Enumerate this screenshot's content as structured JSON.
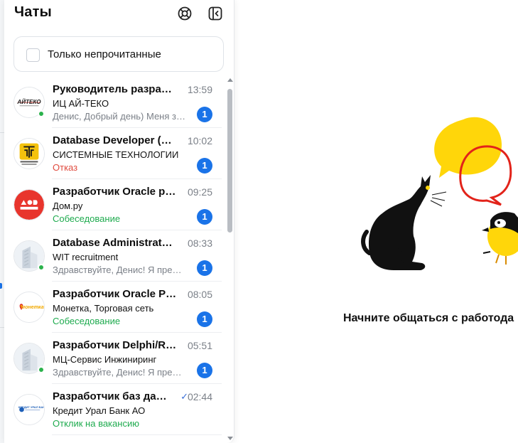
{
  "chat": {
    "title": "Чаты",
    "filter_label": "Только непрочитанные",
    "items": [
      {
        "title": "Руководитель разраб…",
        "time": "13:59",
        "company": "ИЦ АЙ-ТЕКО",
        "status": "Денис, Добрый день) Меня з…",
        "status_color": "#7b8088",
        "unread": "1",
        "online": true,
        "logo": "aiteko",
        "logo_text": "АЙТЕКО"
      },
      {
        "title": "Database Developer (О…",
        "time": "10:02",
        "company": "СИСТЕМНЫЕ ТЕХНОЛОГИИ",
        "status": "Отказ",
        "status_color": "#e04b3f",
        "unread": "1",
        "online": false,
        "logo": "sistech",
        "logo_text": "СИСТЕМНЫЕ ТЕХНОЛОГИИ"
      },
      {
        "title": "Разработчик Oracle pl…",
        "time": "09:25",
        "company": "Дом.ру",
        "status": "Собеседование",
        "status_color": "#1fab4f",
        "unread": "1",
        "online": false,
        "logo": "domru",
        "logo_text": "ДОМ.РУ"
      },
      {
        "title": "Database Administrat…",
        "time": "08:33",
        "company": "WIT recruitment",
        "status": "Здравствуйте, Денис! Я пре…",
        "status_color": "#7b8088",
        "unread": "1",
        "online": true,
        "logo": "building",
        "logo_text": ""
      },
      {
        "title": "Разработчик Oracle P…",
        "time": "08:05",
        "company": "Монетка, Торговая сеть",
        "status": "Собеседование",
        "status_color": "#1fab4f",
        "unread": "1",
        "online": false,
        "logo": "monetka",
        "logo_text": "монетка"
      },
      {
        "title": "Разработчик Delphi/R…",
        "time": "05:51",
        "company": "МЦ-Сервис Инжиниринг",
        "status": "Здравствуйте, Денис! Я пре…",
        "status_color": "#7b8088",
        "unread": "1",
        "online": true,
        "logo": "building",
        "logo_text": ""
      },
      {
        "title": "Разработчик баз да…",
        "time": "02:44",
        "company": "Кредит Урал Банк АО",
        "status": "Отклик на вакансию",
        "status_color": "#1fab4f",
        "unread": "",
        "online": false,
        "logo": "kub",
        "logo_text": "КРЕДИТ УРАЛ БАНК"
      }
    ],
    "read_check": "✓"
  },
  "empty_state": {
    "text": "Начните общаться с работода"
  },
  "colors": {
    "accent": "#1a73e8",
    "online": "#2bb24c",
    "success": "#1fab4f",
    "danger": "#e04b3f",
    "muted": "#7b8088"
  },
  "icons": {
    "support": "lifebuoy-icon",
    "collapse": "collapse-panel-icon"
  }
}
